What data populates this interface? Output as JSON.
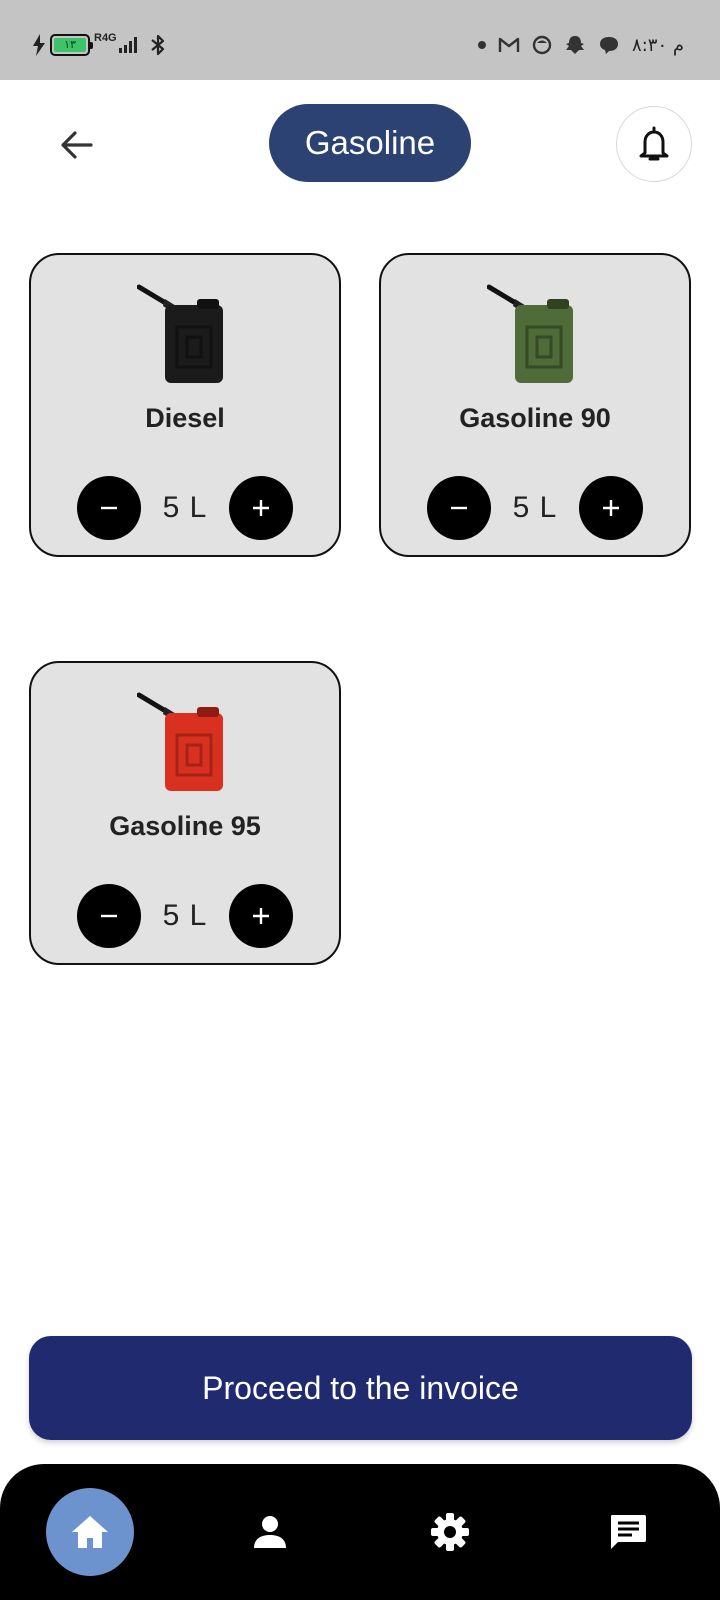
{
  "status_bar": {
    "battery_level": "۱۳",
    "network": "R4G",
    "clock": "۸:۳۰ م",
    "icons": [
      "charging-icon",
      "battery-icon",
      "signal-icon",
      "bluetooth-icon",
      "dot-icon",
      "gmail-icon",
      "app-icon",
      "snapchat-icon",
      "chat-bubble-icon"
    ]
  },
  "header": {
    "title": "Gasoline",
    "back_icon": "arrow-left-icon",
    "notification_icon": "bell-icon"
  },
  "products": [
    {
      "name": "Diesel",
      "quantity": "5 L",
      "can_color": "#1b1b1b"
    },
    {
      "name": "Gasoline 90",
      "quantity": "5 L",
      "can_color": "#4e6b38"
    },
    {
      "name": "Gasoline 95",
      "quantity": "5 L",
      "can_color": "#d9301f"
    }
  ],
  "proceed_button": {
    "label": "Proceed to the invoice"
  },
  "bottom_nav": {
    "items": [
      {
        "icon": "home-icon",
        "active": true
      },
      {
        "icon": "person-icon",
        "active": false
      },
      {
        "icon": "gear-icon",
        "active": false
      },
      {
        "icon": "message-icon",
        "active": false
      }
    ]
  },
  "colors": {
    "title_pill": "#2c4273",
    "proceed_button": "#1f2b6e",
    "nav_active": "#6d93cf",
    "card_bg": "#e2e2e2"
  }
}
